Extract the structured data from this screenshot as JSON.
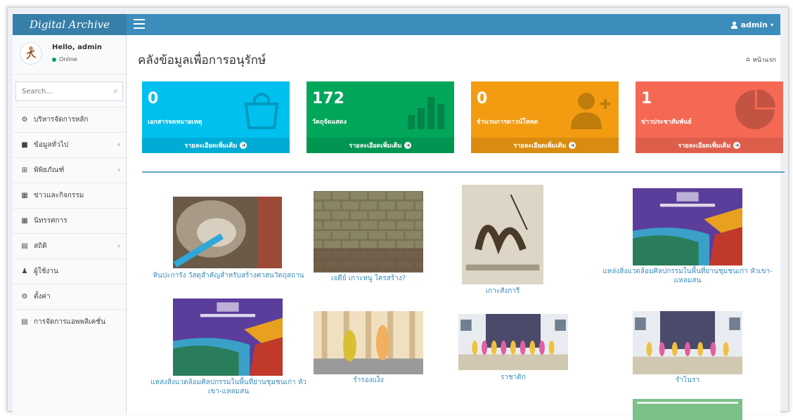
{
  "brand": "Digital Archive",
  "user": {
    "name": "admin",
    "hello": "Hello, admin",
    "status": "Online"
  },
  "search": {
    "placeholder": "Search..."
  },
  "menu": [
    {
      "label": "บริหารจัดการหลัก",
      "icon": "dashboard-icon",
      "glyph": "⚙",
      "chevron": false
    },
    {
      "label": "ข้อมูลทั่วไป",
      "icon": "book-icon",
      "glyph": "■",
      "chevron": true
    },
    {
      "label": "พิพิธภัณฑ์",
      "icon": "grid-icon",
      "glyph": "⊞",
      "chevron": true
    },
    {
      "label": "ข่าวและกิจกรรม",
      "icon": "calendar-icon",
      "glyph": "▦",
      "chevron": false
    },
    {
      "label": "นิทรรศการ",
      "icon": "calendar-icon",
      "glyph": "▦",
      "chevron": false
    },
    {
      "label": "สถิติ",
      "icon": "chart-icon",
      "glyph": "▤",
      "chevron": true
    },
    {
      "label": "ผู้ใช้งาน",
      "icon": "user-icon",
      "glyph": "♟",
      "chevron": false
    },
    {
      "label": "ตั้งค่า",
      "icon": "gear-icon",
      "glyph": "⚙",
      "chevron": false
    },
    {
      "label": "การจัดการแอพพลิเคชั่น",
      "icon": "list-icon",
      "glyph": "▤",
      "chevron": false
    }
  ],
  "page": {
    "title": "คลังข้อมูลเพื่อการอนุรักษ์",
    "breadcrumb": "หน้าแรก"
  },
  "stats": [
    {
      "value": "0",
      "label": "เอกสารจดหมายเหตุ",
      "more": "รายละเอียดเพิ่มเติม",
      "color": "#00c0ef",
      "icon": "shopping-bag-icon"
    },
    {
      "value": "172",
      "label": "วัตถุจัดแสดง",
      "more": "รายละเอียดเพิ่มเติม",
      "color": "#00a65a",
      "icon": "bar-chart-icon"
    },
    {
      "value": "0",
      "label": "จำนวนการดาวน์โหลด",
      "more": "รายละเอียดเพิ่มเติม",
      "color": "#f39c12",
      "icon": "user-plus-icon"
    },
    {
      "value": "1",
      "label": "ข่าวประชาสัมพันธ์",
      "more": "รายละเอียดเพิ่มเติม",
      "color": "#f56954",
      "icon": "pie-chart-icon"
    }
  ],
  "gallery": [
    {
      "caption": "หินปะการัง วัสดุสำคัญสำหรับสร้างศาสนวัตถุสถาน",
      "kind": "coral"
    },
    {
      "caption": "เจดีย์ เกาะหนู ใครสร้าง?",
      "kind": "bricks"
    },
    {
      "caption": "เกาะสังการี",
      "kind": "painting"
    },
    {
      "caption": "แหล่งสิ่งแวดล้อมศิลปกรรมในพื้นที่ย่านชุมชนเก่า หัวเขา-แหลมสน",
      "kind": "book"
    },
    {
      "caption": "แหล่งสิ่งแวดล้อมศิลปกรรมในพื้นที่ย่านชุมชนเก่า หัวเขา-แหลมสน",
      "kind": "book"
    },
    {
      "caption": "รำรองแง็ง",
      "kind": "dance1"
    },
    {
      "caption": "ราชาติก",
      "kind": "dance2"
    },
    {
      "caption": "รำโนรา",
      "kind": "dance3"
    }
  ]
}
